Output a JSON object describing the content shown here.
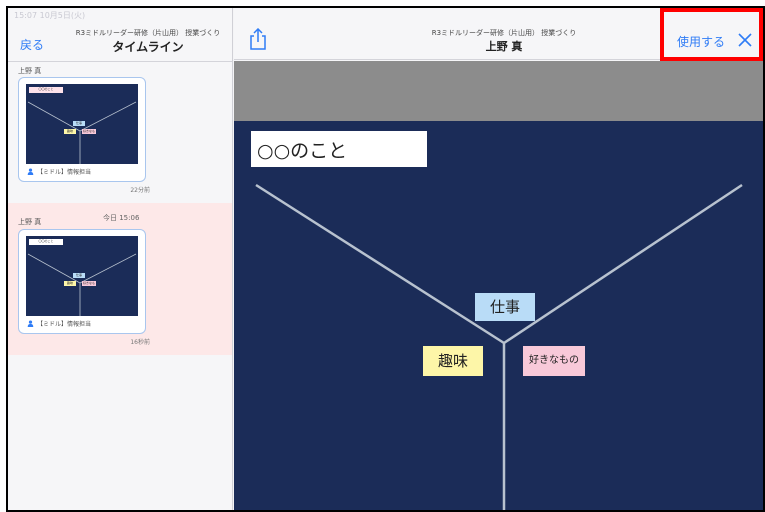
{
  "status_bar": {
    "text": "15:07  10月5日(火)"
  },
  "left_header": {
    "back_label": "戻る",
    "subtitle": "R3ミドルリーダー研修（片山用） 授業づくり",
    "title": "タイムライン"
  },
  "timeline": {
    "date_separator": "今日 15:06",
    "entries": [
      {
        "author": "上野 真",
        "label": "【ミドル】情報担当",
        "time": "22分前",
        "thumb": {
          "title": "〇〇のこと",
          "work": "仕事",
          "hobby": "趣味",
          "like": "好きなもの"
        }
      },
      {
        "author": "上野 真",
        "label": "【ミドル】情報担当",
        "time": "16秒前",
        "thumb": {
          "title": "〇〇のこと",
          "work": "仕事",
          "hobby": "趣味",
          "like": "好きなもの"
        }
      }
    ]
  },
  "right_header": {
    "subtitle": "R3ミドルリーダー研修（片山用） 授業づくり",
    "title": "上野 真",
    "use_label": "使用する"
  },
  "canvas": {
    "title_card": "○○のこと",
    "notes": {
      "work": "仕事",
      "hobby": "趣味",
      "like": "好きなもの"
    },
    "colors": {
      "background": "#1b2c58",
      "work": "#b9dcf7",
      "hobby": "#fdf6a8",
      "like": "#f8c9d9",
      "lines": "#b8c2cf"
    }
  },
  "icons": {
    "share": "share-icon",
    "close": "close-icon",
    "person": "person-icon"
  },
  "accent_color": "#2f7cf6",
  "highlight_color": "#ff0000"
}
